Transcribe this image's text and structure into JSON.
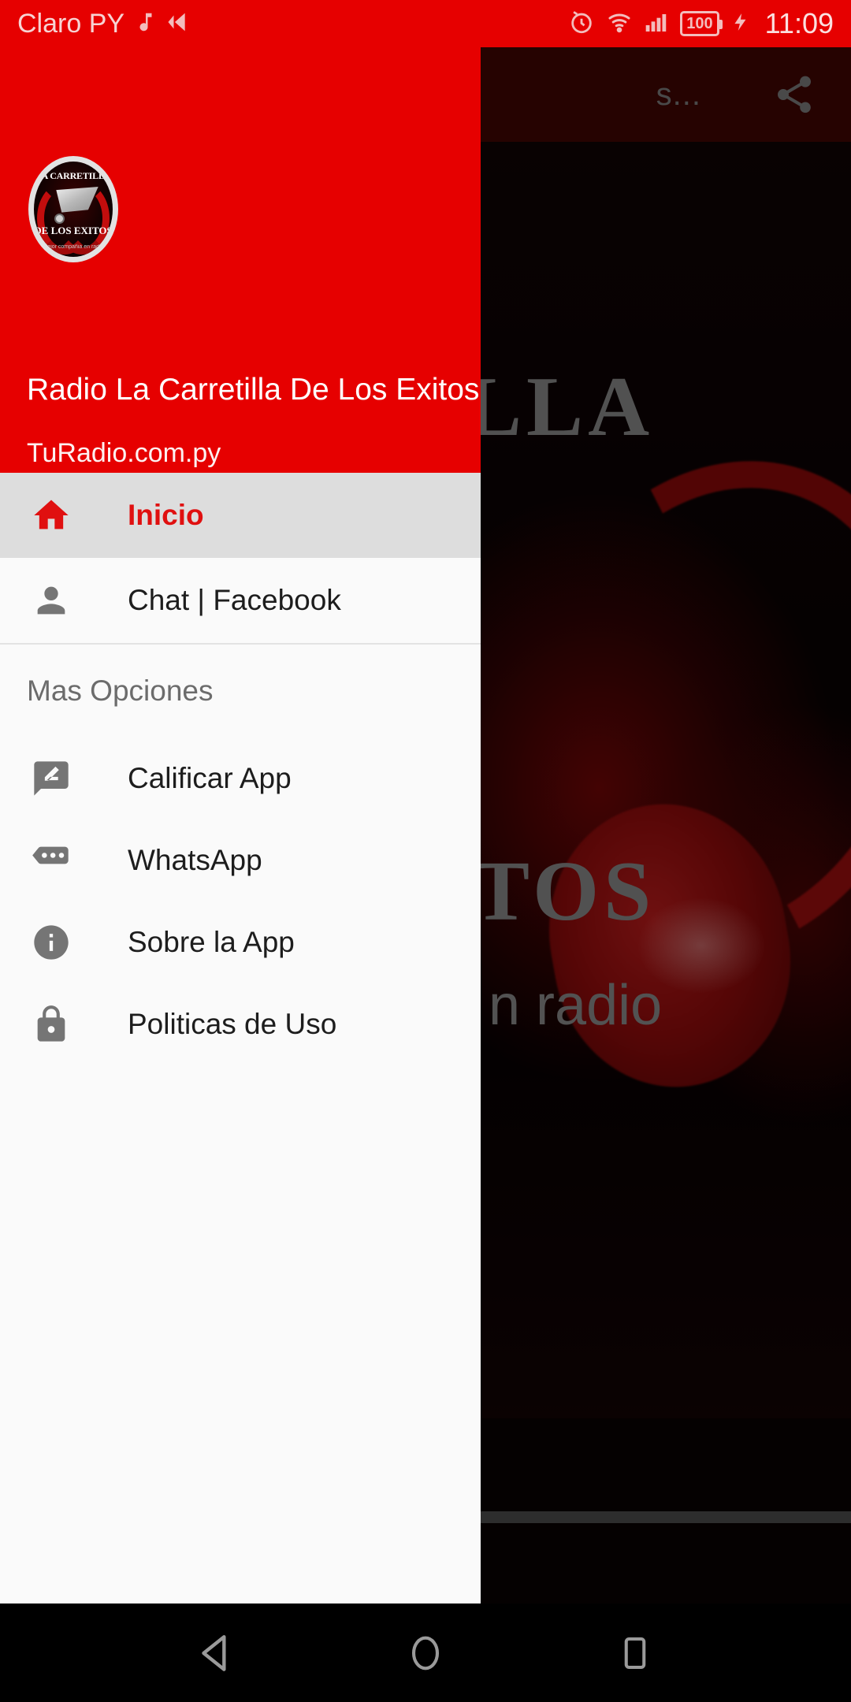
{
  "status_bar": {
    "carrier": "Claro PY",
    "music_icon": "music-note-icon",
    "sound_icon": "sound-off-icon",
    "alarm_icon": "alarm-icon",
    "wifi_icon": "wifi-icon",
    "signal_icon": "cellular-signal-icon",
    "battery_level": "100",
    "charging_icon": "charging-bolt-icon",
    "clock": "11:09",
    "background_color": "#e60000",
    "text_color": "#f7d3d3"
  },
  "background_app": {
    "app_bar": {
      "title": "s...",
      "share_icon": "share-icon",
      "background_color": "#4a0603"
    },
    "hero": {
      "word_top": "LLA",
      "word_bottom": "TOS",
      "subtitle": "n radio",
      "art": "red-headphones-artwork"
    },
    "seek_bar": "playback-progress-bar"
  },
  "drawer": {
    "accent_color": "#e60000",
    "header": {
      "title": "Radio La Carretilla De Los Exitos",
      "subtitle": "TuRadio.com.py",
      "logo": {
        "name": "radio-station-logo",
        "top_text": "LA CARRETILLA",
        "bottom_text": "DE LOS EXITOS",
        "tagline": "mejor compañia en radio"
      }
    },
    "primary_items": [
      {
        "label": "Inicio",
        "icon": "home-icon",
        "selected": true
      },
      {
        "label": "Chat | Facebook",
        "icon": "person-icon",
        "selected": false
      }
    ],
    "section_title": "Mas Opciones",
    "more_items": [
      {
        "label": "Calificar App",
        "icon": "rate-review-icon"
      },
      {
        "label": "WhatsApp",
        "icon": "chat-bubble-dots-icon"
      },
      {
        "label": "Sobre la App",
        "icon": "info-icon"
      },
      {
        "label": "Politicas de Uso",
        "icon": "lock-icon"
      }
    ]
  },
  "system_nav": {
    "back": "back-triangle-icon",
    "home": "home-circle-icon",
    "recents": "recents-square-icon"
  }
}
